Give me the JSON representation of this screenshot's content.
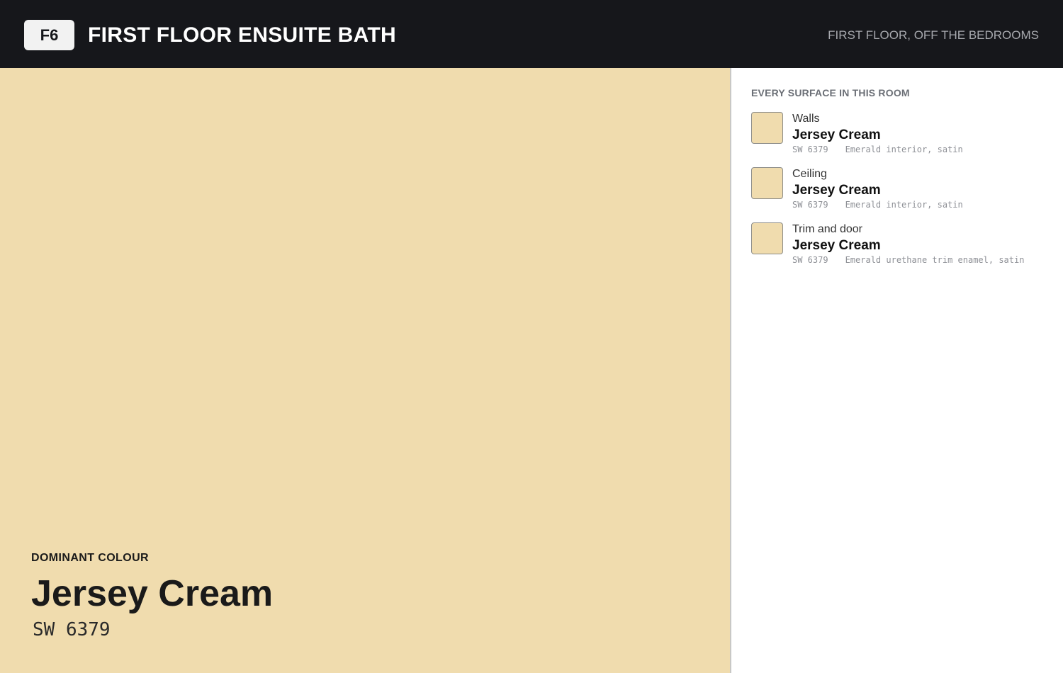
{
  "header": {
    "room_code": "F6",
    "room_title": "FIRST FLOOR ENSUITE BATH",
    "location": "FIRST FLOOR, OFF THE BEDROOMS"
  },
  "dominant": {
    "label": "DOMINANT COLOUR",
    "name": "Jersey Cream",
    "code": "SW 6379",
    "color": "#f0dcae"
  },
  "panel": {
    "heading": "EVERY SURFACE IN THIS ROOM",
    "surfaces": [
      {
        "role": "Walls",
        "name": "Jersey Cream",
        "code": "SW 6379",
        "product": "Emerald interior, satin",
        "color": "#f0dcae"
      },
      {
        "role": "Ceiling",
        "name": "Jersey Cream",
        "code": "SW 6379",
        "product": "Emerald interior, satin",
        "color": "#f0dcae"
      },
      {
        "role": "Trim and door",
        "name": "Jersey Cream",
        "code": "SW 6379",
        "product": "Emerald urethane trim enamel, satin",
        "color": "#f0dcae"
      }
    ]
  },
  "colors": {
    "header_bg": "#16171b",
    "panel_bg": "#ffffff",
    "heading_gray": "#6b6f76"
  }
}
